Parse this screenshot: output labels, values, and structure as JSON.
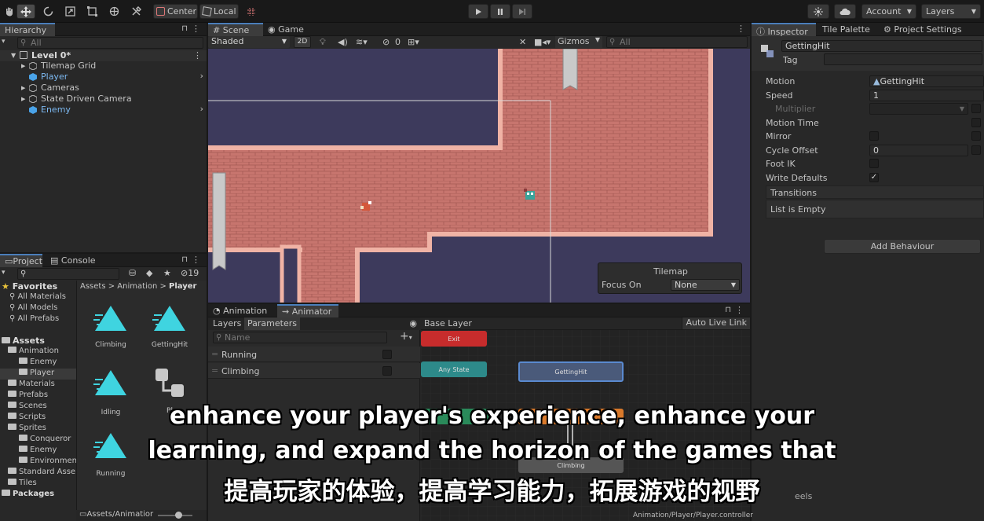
{
  "toolbar": {
    "center": "Center",
    "local": "Local",
    "account": "Account",
    "layers": "Layers"
  },
  "hierarchy": {
    "tab": "Hierarchy",
    "search_placeholder": "All",
    "scene": "Level 0*",
    "items": [
      "Tilemap Grid",
      "Player",
      "Cameras",
      "State Driven Camera",
      "Enemy"
    ]
  },
  "scene_view": {
    "tabs": [
      "Scene",
      "Game"
    ],
    "shading": "Shaded",
    "mode_2d": "2D",
    "fx_count": "0",
    "gizmos": "Gizmos",
    "search_placeholder": "All",
    "overlay": {
      "title": "Tilemap",
      "focus_label": "Focus On",
      "focus_value": "None"
    }
  },
  "project": {
    "tabs": [
      "Project",
      "Console"
    ],
    "count": "19",
    "favorites": {
      "label": "Favorites",
      "items": [
        "All Materials",
        "All Models",
        "All Prefabs"
      ]
    },
    "assets": {
      "label": "Assets",
      "animation": "Animation",
      "animation_children": [
        "Enemy",
        "Player"
      ],
      "folders": [
        "Materials",
        "Prefabs",
        "Scenes",
        "Scripts"
      ],
      "sprites": "Sprites",
      "sprites_children": [
        "Conqueror",
        "Enemy",
        "Environmen"
      ],
      "more": [
        "Standard Asse",
        "Tiles"
      ]
    },
    "packages": "Packages",
    "breadcrumb": [
      "Assets",
      "Animation",
      "Player"
    ],
    "grid": [
      "Climbing",
      "GettingHit",
      "Idling",
      "Pl",
      "Running"
    ],
    "footer_path": "Assets/Animatior"
  },
  "animator": {
    "tabs": [
      "Animation",
      "Animator"
    ],
    "subtabs": [
      "Layers",
      "Parameters"
    ],
    "search_placeholder": "Name",
    "parameters": [
      "Running",
      "Climbing"
    ],
    "base_layer": "Base Layer",
    "auto_live_link": "Auto Live Link",
    "nodes": {
      "exit": "Exit",
      "any_state": "Any State",
      "getting_hit": "GettingHit",
      "climbing": "Climbing"
    },
    "footer": "Animation/Player/Player.controller"
  },
  "inspector": {
    "tabs": [
      "Inspector",
      "Tile Palette",
      "Project Settings"
    ],
    "name": "GettingHit",
    "tag_label": "Tag",
    "fields": {
      "motion_label": "Motion",
      "motion_value": "GettingHit",
      "speed_label": "Speed",
      "speed_value": "1",
      "multiplier_label": "Multiplier",
      "motion_time_label": "Motion Time",
      "mirror_label": "Mirror",
      "cycle_offset_label": "Cycle Offset",
      "cycle_offset_value": "0",
      "foot_ik_label": "Foot IK",
      "write_defaults_label": "Write Defaults"
    },
    "transitions": "Transitions",
    "list_empty": "List is Empty",
    "add_behaviour": "Add Behaviour",
    "partial_label": "eels"
  },
  "subtitles": {
    "line1": "enhance your player's experience, enhance your",
    "line2": "learning, and expand the horizon of the games that",
    "line3": "提高玩家的体验，提高学习能力，拓展游戏的视野"
  },
  "colors": {
    "accent": "#4a7ebb",
    "cube_blue": "#4aa3e8",
    "exit": "#c72c2c",
    "any_state": "#2d8a8a",
    "orange_state": "#d9792b",
    "selected_state": "#4a5a7a",
    "brick": "#c7756e",
    "void": "#3d3a5c"
  }
}
